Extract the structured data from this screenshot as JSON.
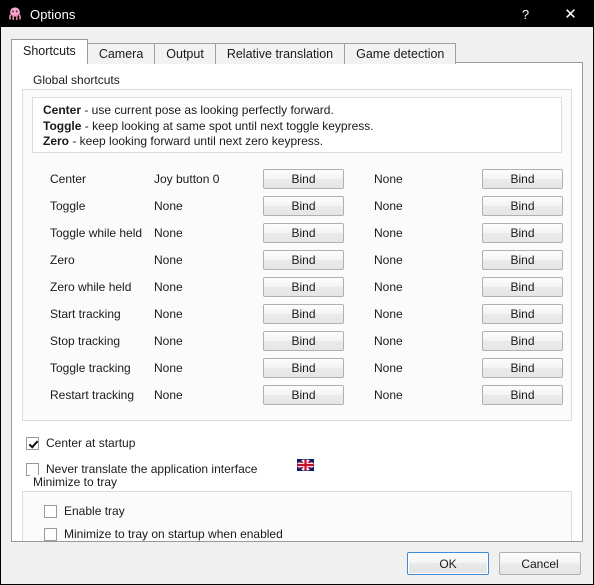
{
  "window": {
    "title": "Options",
    "icon": "octopus-icon",
    "help_label": "?",
    "close_label": "✕"
  },
  "tabs": [
    {
      "label": "Shortcuts",
      "active": true
    },
    {
      "label": "Camera",
      "active": false
    },
    {
      "label": "Output",
      "active": false
    },
    {
      "label": "Relative translation",
      "active": false
    },
    {
      "label": "Game detection",
      "active": false
    }
  ],
  "global_shortcuts": {
    "title": "Global shortcuts",
    "info": [
      {
        "term": "Center",
        "desc": " - use current pose as looking perfectly forward."
      },
      {
        "term": "Toggle",
        "desc": " - keep looking at same spot until next toggle keypress."
      },
      {
        "term": "Zero",
        "desc": " - keep looking forward until next zero keypress."
      }
    ],
    "bind_button_label": "Bind",
    "rows": [
      {
        "label": "Center",
        "binding1": "Joy button 0",
        "binding2": "None"
      },
      {
        "label": "Toggle",
        "binding1": "None",
        "binding2": "None"
      },
      {
        "label": "Toggle while held",
        "binding1": "None",
        "binding2": "None"
      },
      {
        "label": "Zero",
        "binding1": "None",
        "binding2": "None"
      },
      {
        "label": "Zero while held",
        "binding1": "None",
        "binding2": "None"
      },
      {
        "label": "Start tracking",
        "binding1": "None",
        "binding2": "None"
      },
      {
        "label": "Stop tracking",
        "binding1": "None",
        "binding2": "None"
      },
      {
        "label": "Toggle tracking",
        "binding1": "None",
        "binding2": "None"
      },
      {
        "label": "Restart tracking",
        "binding1": "None",
        "binding2": "None"
      }
    ]
  },
  "options": {
    "center_at_startup": {
      "label": "Center at startup",
      "checked": true
    },
    "never_translate": {
      "label": "Never translate the application interface",
      "checked": false
    },
    "language_flag": "union-jack-flag-icon"
  },
  "minimize_tray": {
    "title": "Minimize to tray",
    "enable_tray": {
      "label": "Enable tray",
      "checked": false
    },
    "minimize_on_startup": {
      "label": "Minimize to tray on startup when enabled",
      "checked": false
    }
  },
  "footer": {
    "ok_label": "OK",
    "cancel_label": "Cancel"
  },
  "colors": {
    "titlebar_bg": "#000000",
    "dialog_bg": "#f0f0f0",
    "page_bg": "#ffffff",
    "focus_blue": "#3c8adb",
    "accent_pink": "#f08ac0"
  }
}
